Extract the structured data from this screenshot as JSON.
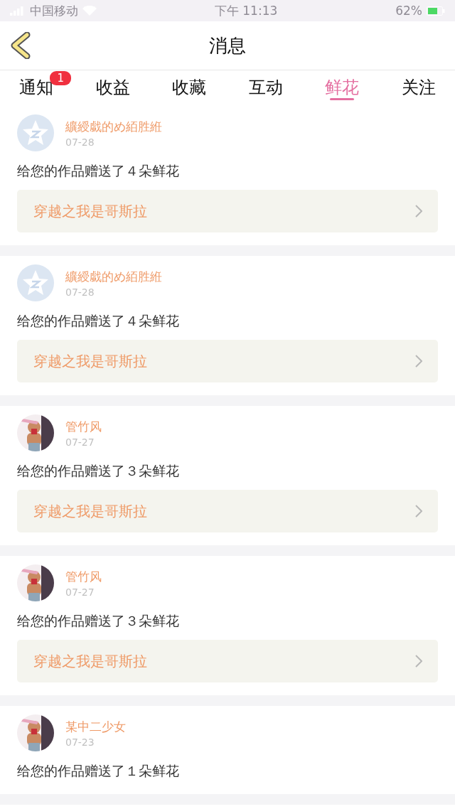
{
  "status_bar": {
    "carrier": "中国移动",
    "time": "下午 11:13",
    "battery": "62%"
  },
  "header": {
    "title": "消息"
  },
  "tabs": [
    {
      "label": "通知",
      "selected": false,
      "badge": "1"
    },
    {
      "label": "收益",
      "selected": false
    },
    {
      "label": "收藏",
      "selected": false
    },
    {
      "label": "互动",
      "selected": false
    },
    {
      "label": "鲜花",
      "selected": true
    },
    {
      "label": "关注",
      "selected": false
    }
  ],
  "messages": [
    {
      "user": "纊綬戱的め絔胜絍",
      "date": "07-28",
      "avatar": {
        "kind": "default"
      },
      "text": "给您的作品赠送了４朵鲜花",
      "book": "穿越之我是哥斯拉"
    },
    {
      "user": "纊綬戱的め絔胜絍",
      "date": "07-28",
      "avatar": {
        "kind": "default"
      },
      "text": "给您的作品赠送了４朵鲜花",
      "book": "穿越之我是哥斯拉"
    },
    {
      "user": "管竹风",
      "date": "07-27",
      "text": "给您的作品赠送了３朵鲜花",
      "book": "穿越之我是哥斯拉"
    },
    {
      "user": "管竹风",
      "date": "07-27",
      "text": "给您的作品赠送了３朵鲜花",
      "book": "穿越之我是哥斯拉"
    },
    {
      "user": "某中二少女",
      "date": "07-23",
      "text": "给您的作品赠送了１朵鲜花"
    }
  ]
}
